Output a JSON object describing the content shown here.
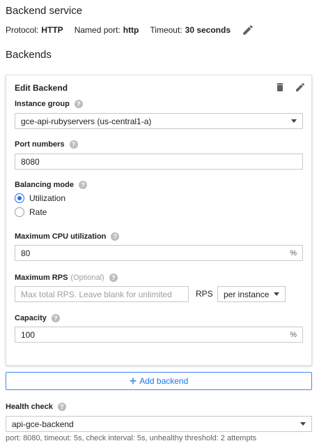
{
  "backend_service": {
    "title": "Backend service",
    "protocol_label": "Protocol:",
    "protocol_value": "HTTP",
    "named_port_label": "Named port:",
    "named_port_value": "http",
    "timeout_label": "Timeout:",
    "timeout_value": "30 seconds"
  },
  "backends": {
    "title": "Backends",
    "card": {
      "title": "Edit Backend",
      "instance_group": {
        "label": "Instance group",
        "value": "gce-api-rubyservers (us-central1-a)"
      },
      "port_numbers": {
        "label": "Port numbers",
        "value": "8080"
      },
      "balancing_mode": {
        "label": "Balancing mode",
        "options": [
          {
            "label": "Utilization",
            "selected": true
          },
          {
            "label": "Rate",
            "selected": false
          }
        ]
      },
      "max_cpu": {
        "label": "Maximum CPU utilization",
        "value": "80",
        "suffix": "%"
      },
      "max_rps": {
        "label": "Maximum RPS",
        "optional": "(Optional)",
        "placeholder": "Max total RPS. Leave blank for unlimited",
        "unit": "RPS",
        "mode": "per instance"
      },
      "capacity": {
        "label": "Capacity",
        "value": "100",
        "suffix": "%"
      }
    },
    "add_label": "Add backend"
  },
  "health_check": {
    "label": "Health check",
    "value": "api-gce-backend",
    "hint": "port: 8080, timeout: 5s, check interval: 5s, unhealthy threshold: 2 attempts"
  },
  "colors": {
    "accent": "#1a73e8",
    "border": "#c8c8c8"
  },
  "icons": [
    "pencil-icon",
    "trash-icon",
    "help-icon",
    "dropdown-caret-icon",
    "plus-icon"
  ]
}
